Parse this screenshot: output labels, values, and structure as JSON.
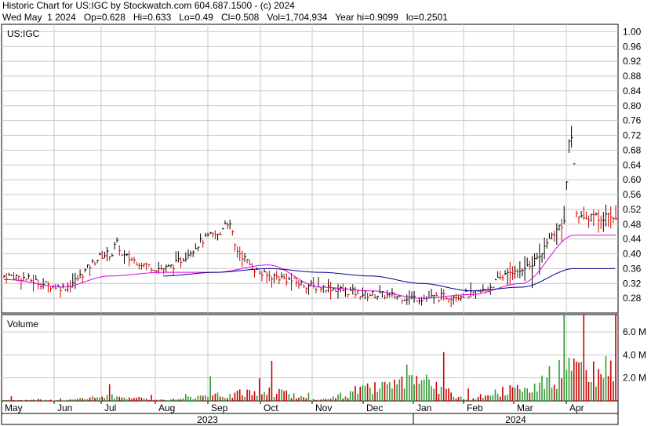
{
  "header": {
    "line1": "Historic Chart for US:IGC by Stockwatch.com 604.687.1500 - (c) 2024",
    "line2": "Wed May  1 2024   Op=0.628   Hi=0.633   Lo=0.49   Cl=0.508   Vol=1,704,934   Year hi=0.9099   lo=0.2501"
  },
  "colors": {
    "up": "#000000",
    "down": "#cc0000",
    "ma_short": "#e600e6",
    "ma_long": "#00008b",
    "vol_up": "#339933",
    "vol_down": "#cc0000",
    "grid": "#c8c8c8"
  },
  "chart_data": [
    {
      "type": "line",
      "title": "US:IGC",
      "series": [
        {
          "name": "",
          "x": [
            "May",
            "Jun",
            "Jul",
            "Aug",
            "Sep",
            "Oct",
            "Nov",
            "Dec",
            "Jan",
            "Feb",
            "Mar",
            "Apr"
          ],
          "values": [
            0.34,
            0.31,
            0.4,
            0.36,
            0.45,
            0.34,
            0.31,
            0.29,
            0.28,
            0.29,
            0.36,
            0.5
          ]
        },
        {
          "name": "",
          "x": [
            "May",
            "Jun",
            "Jul",
            "Aug",
            "Sep",
            "Oct",
            "Nov",
            "Dec",
            "Jan",
            "Feb",
            "Mar",
            "Apr"
          ],
          "values": [
            0.33,
            0.31,
            0.34,
            0.35,
            0.35,
            0.37,
            0.31,
            0.3,
            0.28,
            0.29,
            0.32,
            0.45
          ]
        },
        {
          "name": "",
          "x": [
            "Aug",
            "Sep",
            "Oct",
            "Nov",
            "Dec",
            "Jan",
            "Feb",
            "Mar",
            "Apr"
          ],
          "values": [
            0.34,
            0.35,
            0.36,
            0.35,
            0.34,
            0.32,
            0.3,
            0.31,
            0.36
          ]
        }
      ],
      "y_ticks": [
        "1.00",
        "0.96",
        "0.92",
        "0.88",
        "0.84",
        "0.80",
        "0.76",
        "0.72",
        "0.68",
        "0.64",
        "0.60",
        "0.56",
        "0.52",
        "0.48",
        "0.44",
        "0.40",
        "0.36",
        "0.32",
        "0.28"
      ],
      "ylim": [
        0.24,
        1.02
      ],
      "x_ticks": [
        "May",
        "Jun",
        "Jul",
        "Aug",
        "Sep",
        "Oct",
        "Nov",
        "Dec",
        "Jan",
        "Feb",
        "Mar",
        "Apr"
      ],
      "years": [
        "2023",
        "2024"
      ],
      "grid": true
    },
    {
      "type": "bar",
      "title": "Volume",
      "categories": [
        "May",
        "Jun",
        "Jul",
        "Aug",
        "Sep",
        "Oct",
        "Nov",
        "Dec",
        "Jan",
        "Feb",
        "Mar",
        "Apr"
      ],
      "values": [
        0.2,
        0.2,
        1.0,
        0.3,
        1.2,
        2.3,
        0.3,
        2.8,
        4.0,
        0.5,
        3.0,
        6.8
      ],
      "y_ticks": [
        "6.0 M",
        "4.0 M",
        "2.0 M"
      ],
      "ylim": [
        0,
        7.5
      ],
      "grid": true
    }
  ]
}
